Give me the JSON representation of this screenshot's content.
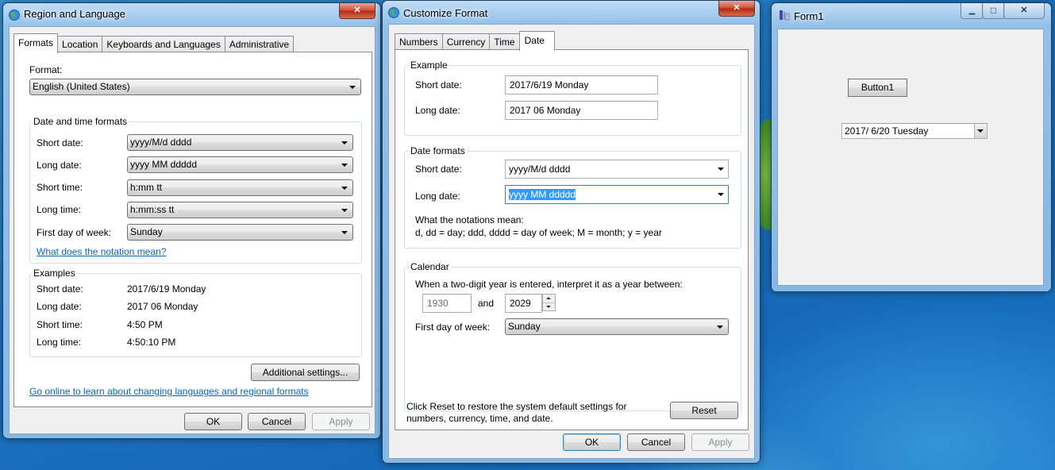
{
  "region": {
    "title": "Region and Language",
    "close_glyph": "✕",
    "tabs": [
      "Formats",
      "Location",
      "Keyboards and Languages",
      "Administrative"
    ],
    "format_label": "Format:",
    "format_value": "English (United States)",
    "dt_group": "Date and time formats",
    "short_date_label": "Short date:",
    "short_date_value": "yyyy/M/d dddd",
    "long_date_label": "Long date:",
    "long_date_value": "yyyy MM ddddd",
    "short_time_label": "Short time:",
    "short_time_value": "h:mm tt",
    "long_time_label": "Long time:",
    "long_time_value": "h:mm:ss tt",
    "first_day_label": "First day of week:",
    "first_day_value": "Sunday",
    "notation_link": "What does the notation mean?",
    "examples_group": "Examples",
    "ex_short_date_label": "Short date:",
    "ex_short_date_value": "2017/6/19 Monday",
    "ex_long_date_label": "Long date:",
    "ex_long_date_value": "2017 06 Monday",
    "ex_short_time_label": "Short time:",
    "ex_short_time_value": "4:50 PM",
    "ex_long_time_label": "Long time:",
    "ex_long_time_value": "4:50:10 PM",
    "additional_button": "Additional settings...",
    "online_link": "Go online to learn about changing languages and regional formats",
    "ok": "OK",
    "cancel": "Cancel",
    "apply": "Apply"
  },
  "customize": {
    "title": "Customize Format",
    "close_glyph": "✕",
    "tabs": [
      "Numbers",
      "Currency",
      "Time",
      "Date"
    ],
    "example_group": "Example",
    "short_date_label": "Short date:",
    "short_date_example": "2017/6/19 Monday",
    "long_date_label": "Long date:",
    "long_date_example": "2017 06 Monday",
    "formats_group": "Date formats",
    "fmt_short_label": "Short date:",
    "fmt_short_value": "yyyy/M/d dddd",
    "fmt_long_label": "Long date:",
    "fmt_long_value": "yyyy MM ddddd",
    "notation_title": "What the notations mean:",
    "notation_text": "d, dd = day;  ddd, dddd = day of week;  M = month;  y = year",
    "calendar_group": "Calendar",
    "twodigit_text": "When a two-digit year is entered, interpret it as a year between:",
    "year_from": "1930",
    "and_label": "and",
    "year_to": "2029",
    "first_day_label": "First day of week:",
    "first_day_value": "Sunday",
    "reset_text_1": "Click Reset to restore the system default settings for",
    "reset_text_2": "numbers, currency, time, and date.",
    "reset_button": "Reset",
    "ok": "OK",
    "cancel": "Cancel",
    "apply": "Apply"
  },
  "form1": {
    "title": "Form1",
    "minimize_glyph": "▁",
    "maximize_glyph": "□",
    "close_glyph": "✕",
    "button1": "Button1",
    "date_value": "2017/  6/20   Tuesday"
  }
}
